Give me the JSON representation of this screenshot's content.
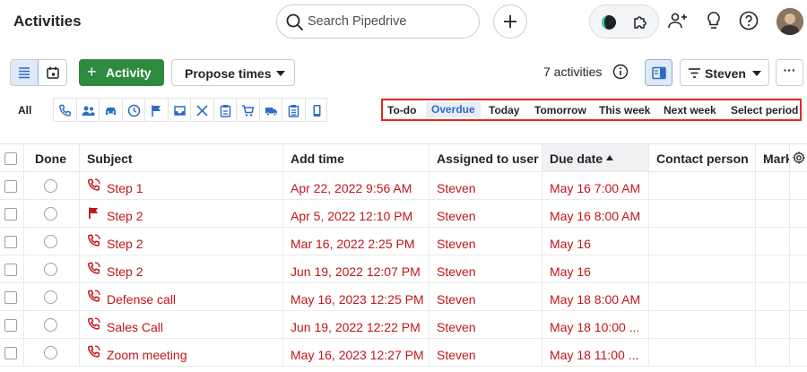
{
  "header": {
    "title": "Activities",
    "search_placeholder": "Search Pipedrive"
  },
  "toolbar": {
    "add_activity_label": "Activity",
    "propose_times_label": "Propose times",
    "activity_count": "7 activities",
    "user_filter_label": "Steven",
    "more_label": "···"
  },
  "type_filter": {
    "all_label": "All",
    "icons": [
      "phone-icon",
      "people-icon",
      "car-icon",
      "clock-icon",
      "flag-icon",
      "inbox-icon",
      "utensils-icon",
      "clipboard-icon",
      "cart-icon",
      "truck-icon",
      "clipboard-list-icon",
      "mobile-icon"
    ]
  },
  "periods": [
    {
      "label": "To-do",
      "active": false
    },
    {
      "label": "Overdue",
      "active": true
    },
    {
      "label": "Today",
      "active": false
    },
    {
      "label": "Tomorrow",
      "active": false
    },
    {
      "label": "This week",
      "active": false
    },
    {
      "label": "Next week",
      "active": false
    },
    {
      "label": "Select period",
      "active": false
    }
  ],
  "table": {
    "columns": [
      "Done",
      "Subject",
      "Add time",
      "Assigned to user",
      "Due date",
      "Contact person",
      "Mark"
    ],
    "rows": [
      {
        "icon": "phone-icon",
        "subject": "Step 1",
        "add_time": "Apr 22, 2022 9:56 AM",
        "assigned": "Steven",
        "due": "May 16 7:00 AM"
      },
      {
        "icon": "flag-icon",
        "subject": "Step 2",
        "add_time": "Apr 5, 2022 12:10 PM",
        "assigned": "Steven",
        "due": "May 16 8:00 AM"
      },
      {
        "icon": "phone-icon",
        "subject": "Step 2",
        "add_time": "Mar 16, 2022 2:25 PM",
        "assigned": "Steven",
        "due": "May 16"
      },
      {
        "icon": "phone-icon",
        "subject": "Step 2",
        "add_time": "Jun 19, 2022 12:07 PM",
        "assigned": "Steven",
        "due": "May 16"
      },
      {
        "icon": "phone-icon",
        "subject": "Defense call",
        "add_time": "May 16, 2023 12:25 PM",
        "assigned": "Steven",
        "due": "May 18 8:00 AM"
      },
      {
        "icon": "phone-icon",
        "subject": "Sales Call",
        "add_time": "Jun 19, 2022 12:22 PM",
        "assigned": "Steven",
        "due": "May 18 10:00 ..."
      },
      {
        "icon": "phone-icon",
        "subject": "Zoom meeting",
        "add_time": "May 16, 2023 12:27 PM",
        "assigned": "Steven",
        "due": "May 18 11:00 ..."
      }
    ]
  },
  "colors": {
    "overdue_red": "#c0161b",
    "accent_green": "#2e8a3e",
    "active_blue": "#2d6bc4",
    "highlight_border": "#e0281f"
  }
}
